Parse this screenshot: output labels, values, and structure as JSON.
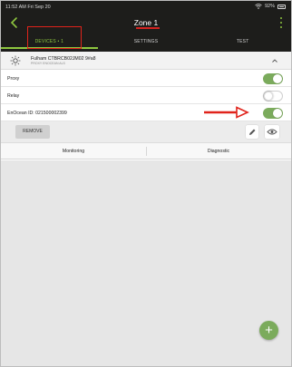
{
  "status_bar": {
    "time": "11:52 AM  Fri Sep 20",
    "battery": "92%"
  },
  "header": {
    "title": "Zone 1"
  },
  "tabs": [
    {
      "label": "DEVICES • 1",
      "active": true
    },
    {
      "label": "SETTINGS",
      "active": false
    },
    {
      "label": "TEST",
      "active": false
    }
  ],
  "device": {
    "name": "Fulham CTBRCB02JM02 9#a8",
    "subtitle": "PROXY ENOCEAN ALS"
  },
  "rows": [
    {
      "label": "Proxy",
      "toggle_on": true
    },
    {
      "label": "Relay",
      "toggle_on": false
    },
    {
      "label": "EnOcean   ID: 021500002399",
      "toggle_on": true
    }
  ],
  "actions": {
    "remove_label": "REMOVE"
  },
  "subtabs": [
    {
      "label": "Monitoring"
    },
    {
      "label": "Diagnostic"
    }
  ],
  "fab": {
    "label": "+"
  },
  "colors": {
    "header": "#1d1d1b",
    "accent": "#8ec63f",
    "toggle_on": "#7bab5c",
    "annotation": "#e0231b",
    "content_bg": "#e6e6e6"
  },
  "icons": [
    "chevron-left-icon",
    "more-vertical-icon",
    "wifi-icon",
    "battery-icon",
    "bulb-icon",
    "chevron-up-icon",
    "pencil-icon",
    "eye-icon",
    "plus-icon"
  ]
}
